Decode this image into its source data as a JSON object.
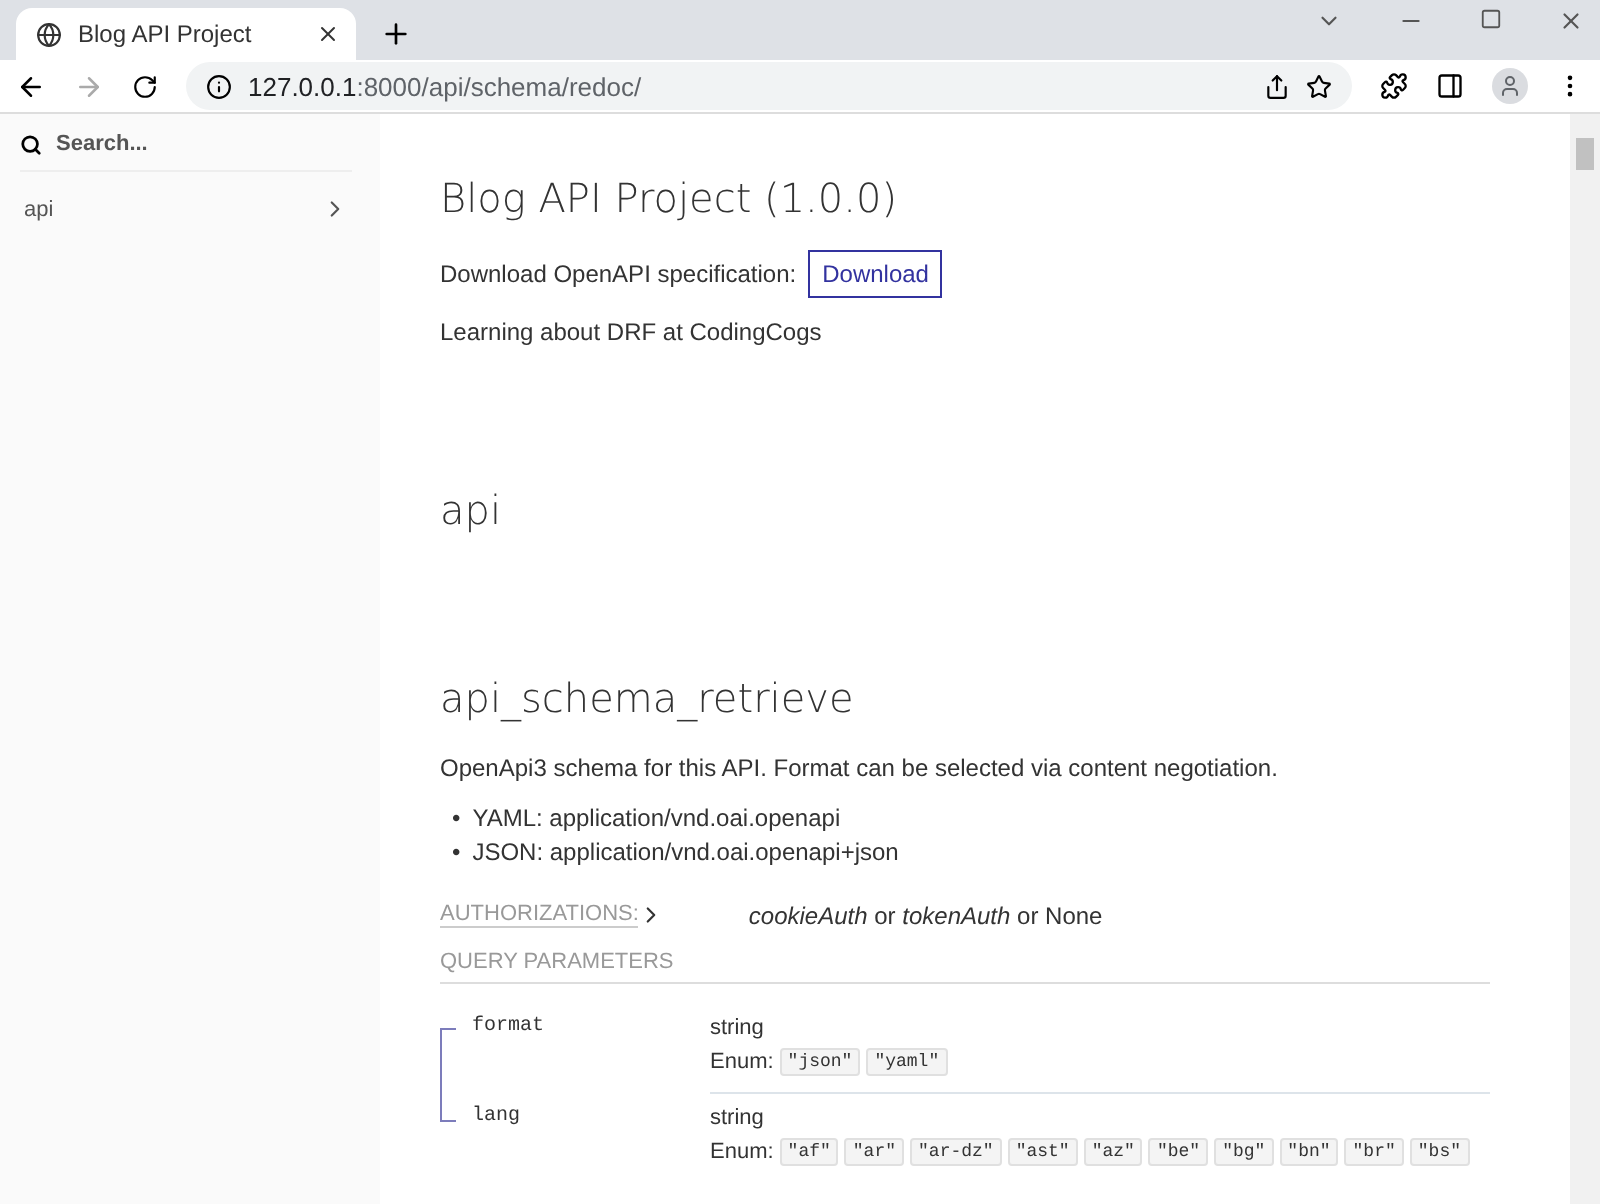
{
  "browser": {
    "tab_title": "Blog API Project",
    "url_host": "127.0.0.1",
    "url_path": ":8000/api/schema/redoc/"
  },
  "sidebar": {
    "search": {
      "placeholder": "Search..."
    },
    "items": [
      {
        "label": "api",
        "expanded": false
      }
    ]
  },
  "info": {
    "title": "Blog API Project (1.0.0)",
    "download_label": "Download OpenAPI specification:",
    "download_button": "Download",
    "description": "Learning about DRF at CodingCogs"
  },
  "tag": {
    "title": "api"
  },
  "operation": {
    "title": "api_schema_retrieve",
    "description": "OpenApi3 schema for this API. Format can be selected via content negotiation.",
    "bullets": [
      {
        "marker": "•",
        "text": "YAML: application/vnd.oai.openapi"
      },
      {
        "marker": "•",
        "text": "JSON: application/vnd.oai.openapi+json"
      }
    ],
    "auth_label": "AUTHORIZATIONS:",
    "auth": [
      {
        "text": "cookieAuth",
        "kind": "scheme"
      },
      {
        "text": " or ",
        "kind": "plain"
      },
      {
        "text": "tokenAuth",
        "kind": "scheme"
      },
      {
        "text": " or None",
        "kind": "plain"
      }
    ],
    "params_title": "QUERY PARAMETERS",
    "params": [
      {
        "name": "format",
        "type": "string",
        "enum_label": "Enum:",
        "enum": [
          "\"json\"",
          "\"yaml\""
        ]
      },
      {
        "name": "lang",
        "type": "string",
        "enum_label": "Enum:",
        "enum": [
          "\"af\"",
          "\"ar\"",
          "\"ar-dz\"",
          "\"ast\"",
          "\"az\"",
          "\"be\"",
          "\"bg\"",
          "\"bn\"",
          "\"br\"",
          "\"bs\""
        ]
      }
    ]
  }
}
